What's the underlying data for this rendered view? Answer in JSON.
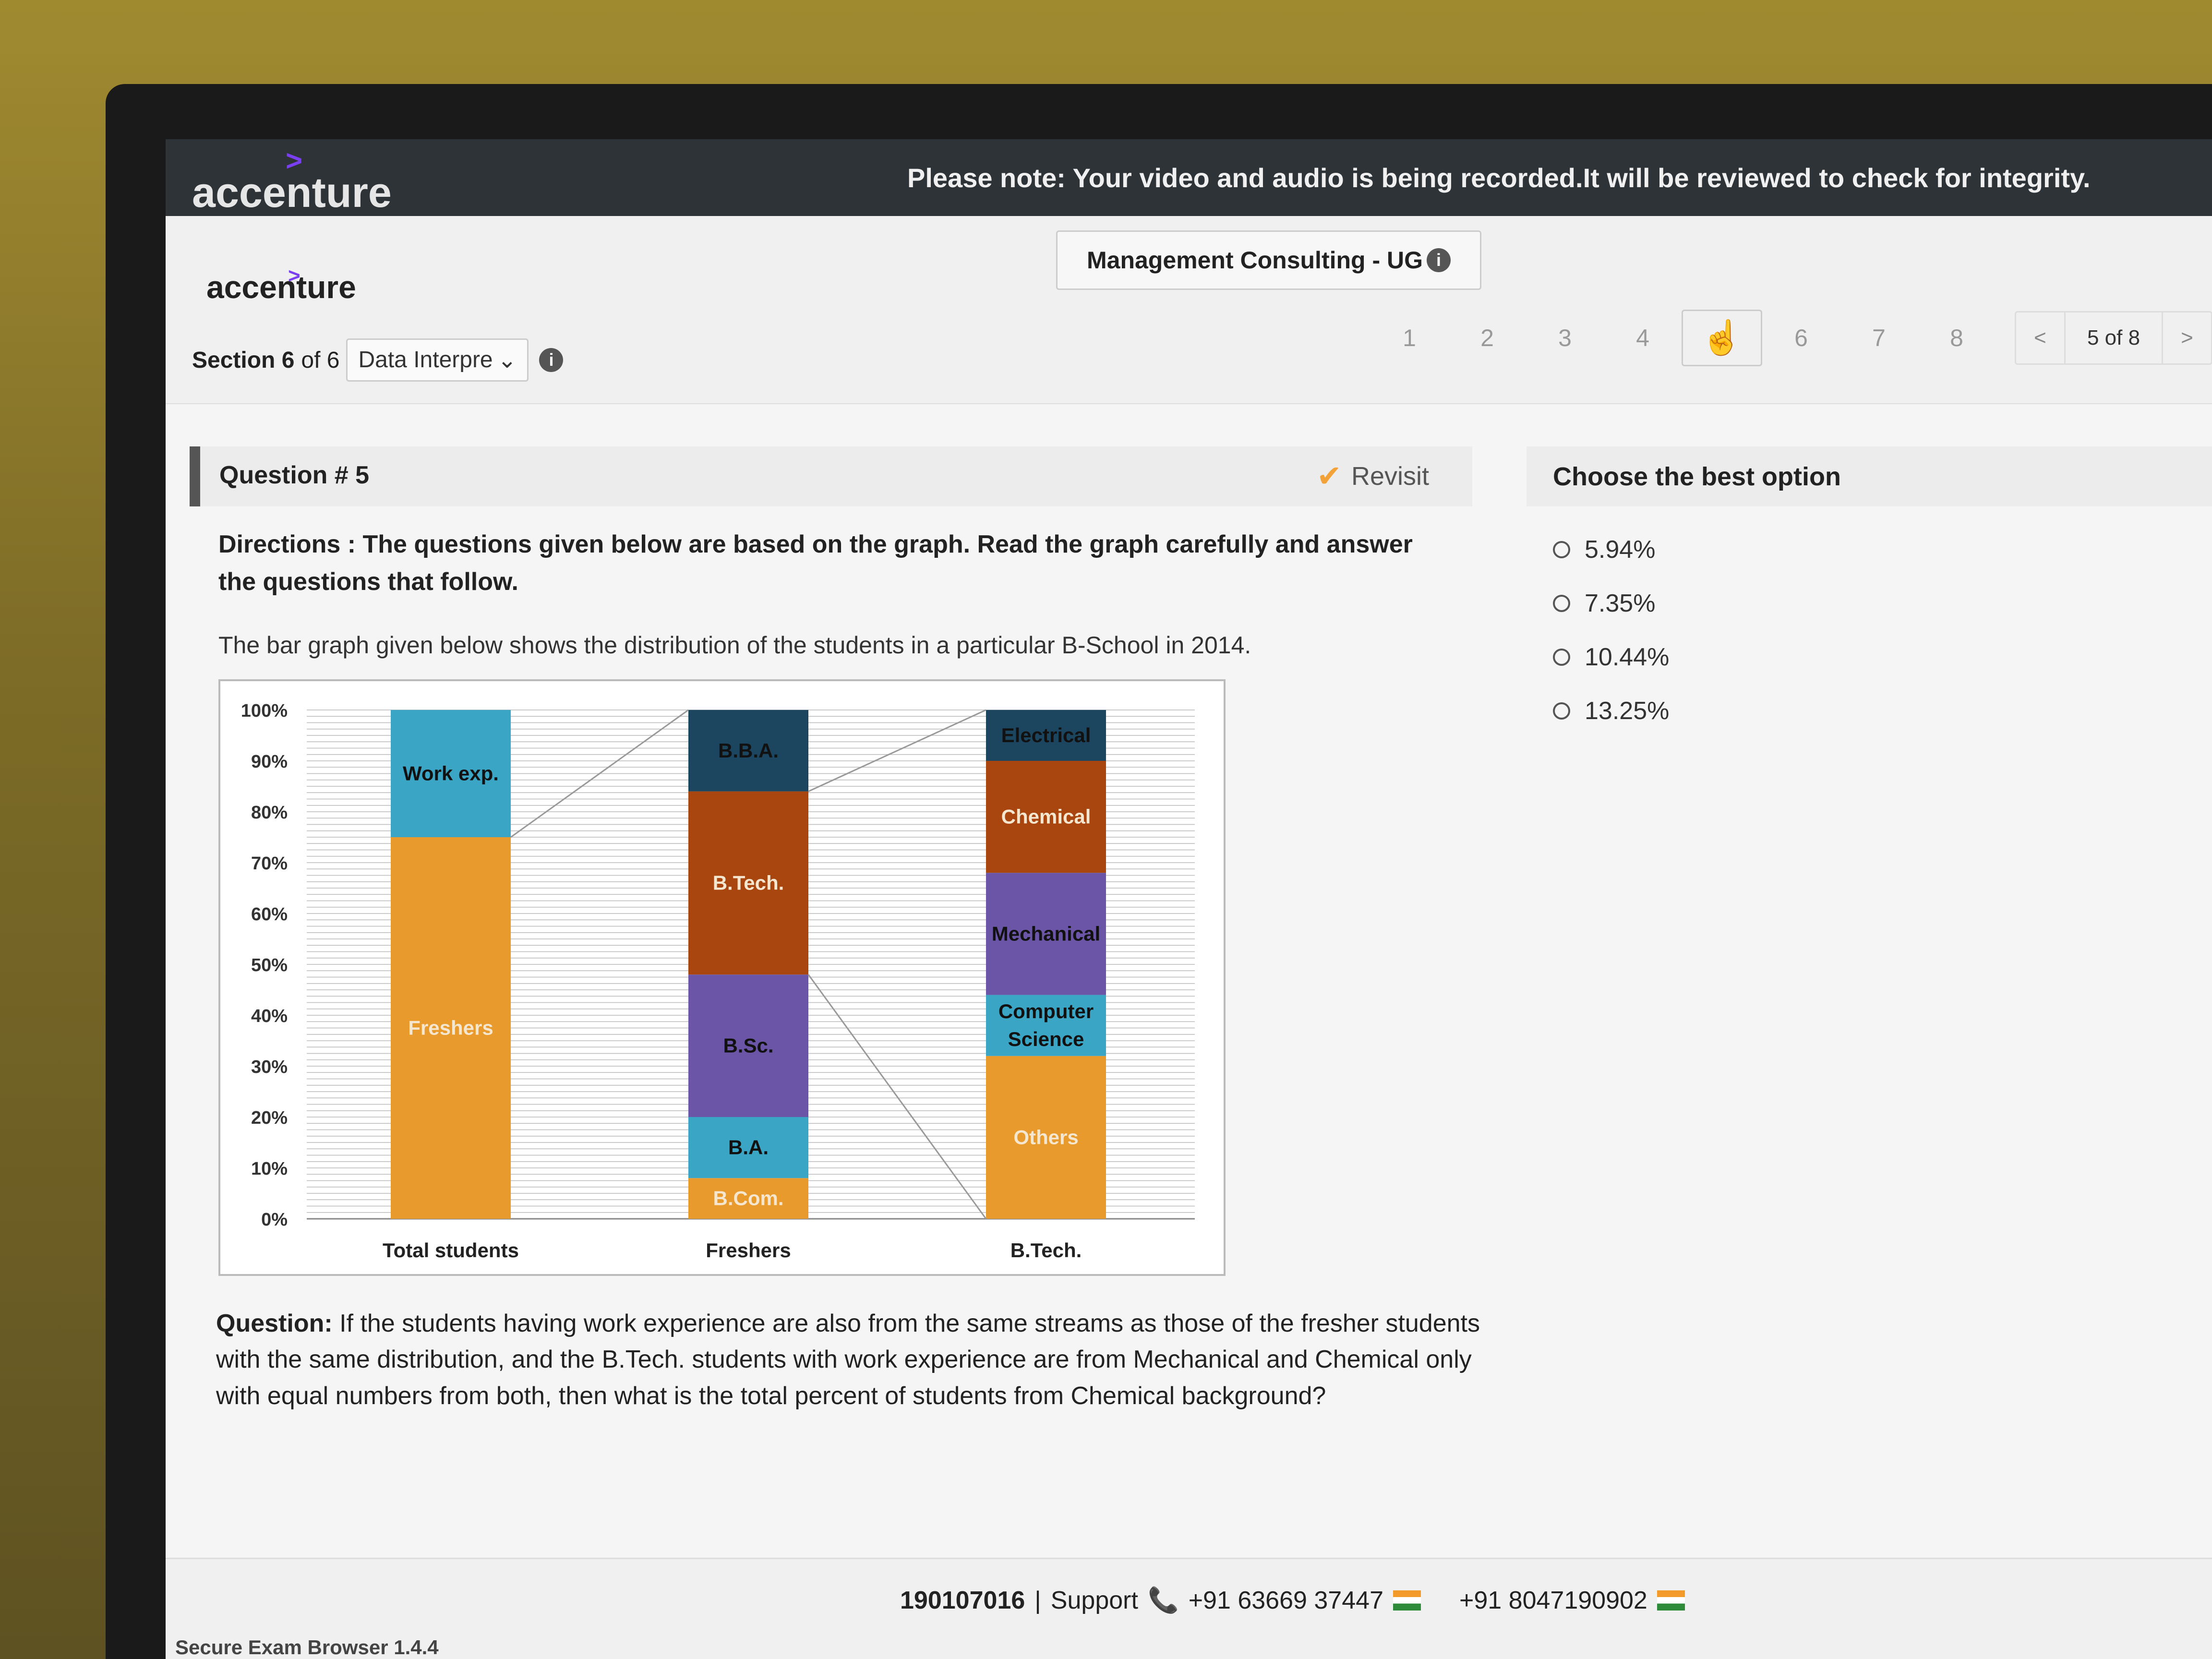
{
  "header": {
    "logo_text": "accenture",
    "notice": "Please note: Your video and audio is being recorded.It will be reviewed to check for integrity."
  },
  "subheader": {
    "logo_text": "accenture",
    "course_name": "Management Consulting - UG",
    "section_label": "Section 6",
    "section_of": "of 6",
    "section_select": "Data Interpre",
    "pages": [
      "1",
      "2",
      "3",
      "4",
      "",
      "6",
      "7",
      "8"
    ],
    "current_page": 5,
    "pager_label": "5 of 8",
    "prev": "<",
    "next": ">"
  },
  "question": {
    "number_label": "Question # 5",
    "revisit_label": "Revisit",
    "directions": "Directions : The questions given below are based on the graph. Read the graph carefully and answer the questions that follow.",
    "description": "The bar graph given below shows the distribution of the students in a particular B-School in 2014.",
    "question_label": "Question:",
    "question_text": "If the students having work experience are also from the same streams as those of the fresher students with the same distribution, and the B.Tech. students with work experience are from Mechanical and Chemical only with equal numbers from both, then what is the total percent of students from Chemical background?"
  },
  "options": {
    "header": "Choose the best option",
    "items": [
      "5.94%",
      "7.35%",
      "10.44%",
      "13.25%"
    ]
  },
  "footer": {
    "id": "190107016",
    "support_label": "Support",
    "phone1": "+91 63669 37447",
    "phone2": "+91 8047190902",
    "version": "Secure Exam Browser 1.4.4"
  },
  "chart_data": {
    "type": "bar",
    "stacked": true,
    "percent": true,
    "categories": [
      "Total students",
      "Freshers",
      "B.Tech."
    ],
    "yticks": [
      "0%",
      "10%",
      "20%",
      "30%",
      "40%",
      "50%",
      "60%",
      "70%",
      "80%",
      "90%",
      "100%"
    ],
    "ylim": [
      0,
      100
    ],
    "bars": [
      {
        "category": "Total students",
        "segments": [
          {
            "label": "Freshers",
            "value": 75,
            "color": "#e99a2c"
          },
          {
            "label": "Work exp.",
            "value": 25,
            "color": "#3ba5c6"
          }
        ]
      },
      {
        "category": "Freshers",
        "segments": [
          {
            "label": "B.Com.",
            "value": 8,
            "color": "#e99a2c"
          },
          {
            "label": "B.A.",
            "value": 12,
            "color": "#3ba5c6"
          },
          {
            "label": "B.Sc.",
            "value": 28,
            "color": "#6a55a6"
          },
          {
            "label": "B.Tech.",
            "value": 36,
            "color": "#a9450f"
          },
          {
            "label": "B.B.A.",
            "value": 16,
            "color": "#1c4560"
          }
        ]
      },
      {
        "category": "B.Tech.",
        "segments": [
          {
            "label": "Others",
            "value": 32,
            "color": "#e99a2c"
          },
          {
            "label": "Computer Science",
            "value": 12,
            "color": "#3ba5c6"
          },
          {
            "label": "Mechanical",
            "value": 24,
            "color": "#6a55a6"
          },
          {
            "label": "Chemical",
            "value": 22,
            "color": "#a9450f"
          },
          {
            "label": "Electrical",
            "value": 10,
            "color": "#1c4560"
          }
        ]
      }
    ]
  }
}
